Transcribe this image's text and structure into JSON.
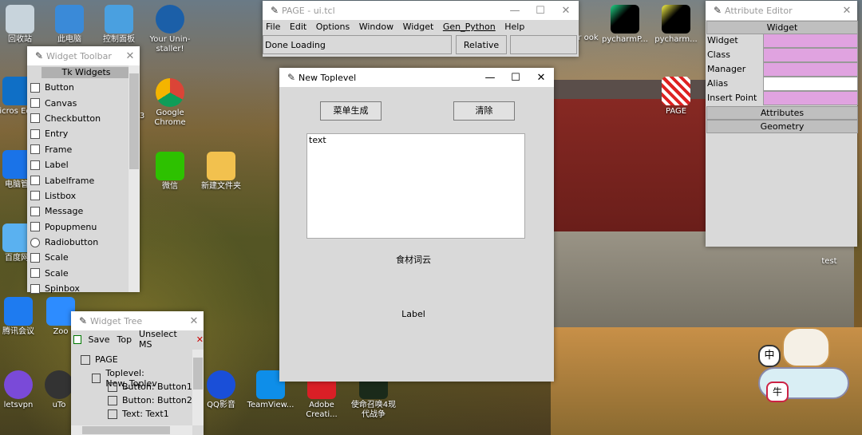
{
  "colors": {
    "field_pink": "#e0a3e0",
    "field_white": "#ffffff",
    "accent_blue": "#0078d7"
  },
  "desktop": {
    "icons": [
      {
        "label": "回收站",
        "icon": "recycle-bin-icon"
      },
      {
        "label": "此电脑",
        "icon": "computer-icon"
      },
      {
        "label": "控制面板",
        "icon": "control-panel-icon"
      },
      {
        "label": "Your Unin-staller!",
        "icon": "uninstaller-icon"
      },
      {
        "label": "pycharmP...",
        "icon": "pycharm-icon"
      },
      {
        "label": "pycharm...",
        "icon": "pycharm-icon"
      },
      {
        "label": "Micros Edge",
        "icon": "edge-icon"
      },
      {
        "label": "Google Chrome",
        "icon": "chrome-icon"
      },
      {
        "label": "PAGE",
        "icon": "page-app-icon"
      },
      {
        "label": "电脑管",
        "icon": "pc-manager-icon"
      },
      {
        "label": "微信",
        "icon": "wechat-icon"
      },
      {
        "label": "新建文件夹",
        "icon": "folder-icon"
      },
      {
        "label": "百度网",
        "icon": "baidu-netdisk-icon"
      },
      {
        "label": "test",
        "icon": "test-icon"
      },
      {
        "label": "腾讯会议",
        "icon": "tencent-meeting-icon"
      },
      {
        "label": "Zoo",
        "icon": "zoom-icon"
      },
      {
        "label": "letsvpn",
        "icon": "letsvpn-icon"
      },
      {
        "label": "uTo",
        "icon": "utorrent-icon"
      },
      {
        "label": "QQ影音",
        "icon": "qq-player-icon"
      },
      {
        "label": "TeamView...",
        "icon": "teamviewer-icon"
      },
      {
        "label": "Adobe Creati...",
        "icon": "adobe-icon"
      },
      {
        "label": "使命召唤4现代战争",
        "icon": "cod-icon"
      },
      {
        "label": "ter ook",
        "icon": "partial-icon"
      },
      {
        "label": "3",
        "icon": "partial-icon"
      }
    ]
  },
  "page_main": {
    "title": "PAGE - ui.tcl",
    "menu": [
      "File",
      "Edit",
      "Options",
      "Window",
      "Widget",
      "Gen_Python",
      "Help"
    ],
    "status": "Done Loading",
    "manager": "Relative"
  },
  "toolbar": {
    "title": "Widget Toolbar",
    "section": "Tk Widgets",
    "items": [
      "Button",
      "Canvas",
      "Checkbutton",
      "Entry",
      "Frame",
      "Label",
      "Labelframe",
      "Listbox",
      "Message",
      "Popupmenu",
      "Radiobutton",
      "Scale",
      "Scale",
      "Spinbox"
    ]
  },
  "toplevel": {
    "title": "New Toplevel",
    "button1": "菜单生成",
    "button2": "清除",
    "text": "text",
    "label1": "食材词云",
    "label2": "Label"
  },
  "tree": {
    "title": "Widget Tree",
    "menu": [
      "Save",
      "Top",
      "Unselect MS"
    ],
    "nodes": [
      "PAGE",
      "Toplevel: New_Toplev",
      "Button: Button1",
      "Button: Button2",
      "Text: Text1"
    ]
  },
  "attr": {
    "title": "Attribute Editor",
    "widget_section": "Widget",
    "rows": [
      {
        "label": "Widget",
        "color": "pink"
      },
      {
        "label": "Class",
        "color": "pink"
      },
      {
        "label": "Manager",
        "color": "pink"
      },
      {
        "label": "Alias",
        "color": "white"
      },
      {
        "label": "Insert Point",
        "color": "pink"
      }
    ],
    "attributes_section": "Attributes",
    "geometry_section": "Geometry"
  }
}
